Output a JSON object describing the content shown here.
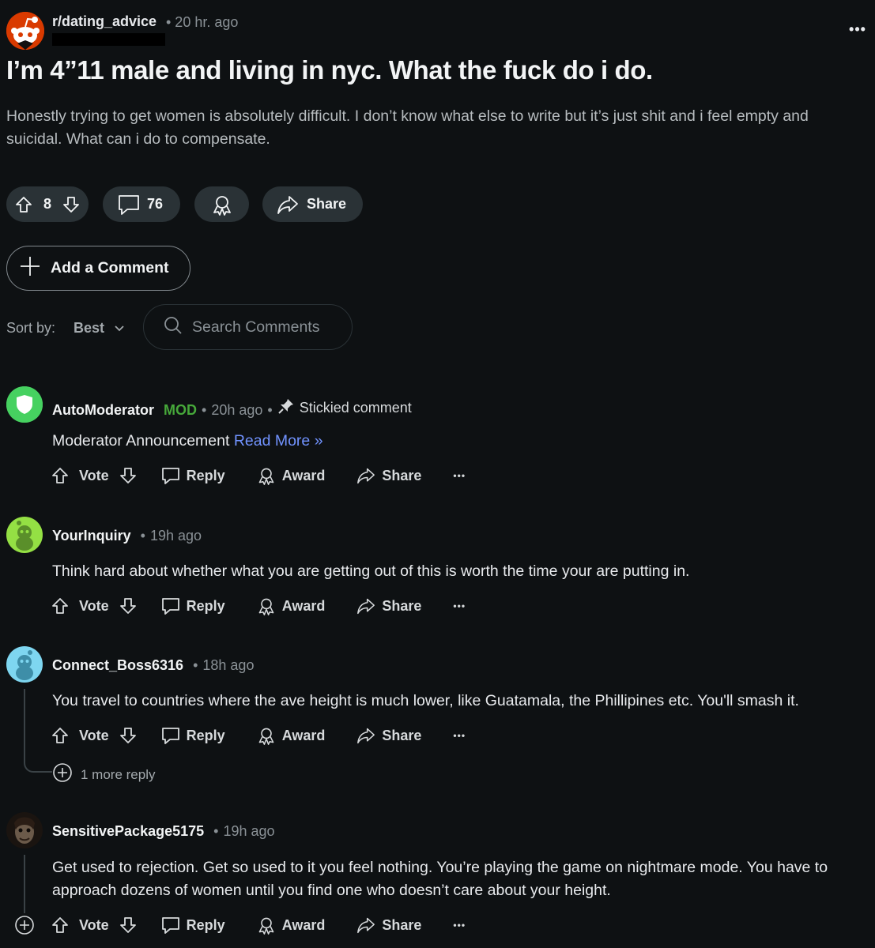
{
  "post": {
    "subreddit": "r/dating_advice",
    "time": "• 20 hr. ago",
    "title": "I’m 4”11 male and living in nyc. What the fuck do i do.",
    "body": "Honestly trying to get women is absolutely difficult. I don’t know what else to write but it’s just shit and i feel empty and suicidal. What can i do to compensate.",
    "overflow": "•••",
    "votes": "8",
    "comments": "76",
    "share_label": "Share"
  },
  "toolbar": {
    "add_comment": "Add a Comment",
    "sort_label": "Sort by:",
    "sort_value": "Best",
    "search_placeholder": "Search Comments"
  },
  "comments": [
    {
      "author": "AutoModerator",
      "badge": "MOD",
      "time": "20h ago",
      "sticky": "Stickied comment",
      "text": "Moderator Announcement ",
      "link": "Read More »"
    },
    {
      "author": "YourInquiry",
      "time": "19h ago",
      "text": "Think hard about whether what you are getting out of this is worth the time your are putting in."
    },
    {
      "author": "Connect_Boss6316",
      "time": "18h ago",
      "text": "You travel to countries where the ave height is much lower, like Guatamala, the Phillipines etc. You'll smash it.",
      "more_replies": "1 more reply"
    },
    {
      "author": "SensitivePackage5175",
      "time": "19h ago",
      "text": "Get used to rejection. Get so used to it you feel nothing. You’re playing the game on nightmare mode. You have to approach dozens of women until you find one who doesn’t care about your height."
    }
  ],
  "comment_actions": {
    "vote": "Vote",
    "reply": "Reply",
    "award": "Award",
    "share": "Share",
    "more": "•••"
  },
  "dot": "•",
  "colors": {
    "background": "#0e1113",
    "pill": "#2a3236",
    "mod_green": "#46a83a",
    "link_blue": "#7193ff",
    "subreddit_red": "#d93a00"
  }
}
